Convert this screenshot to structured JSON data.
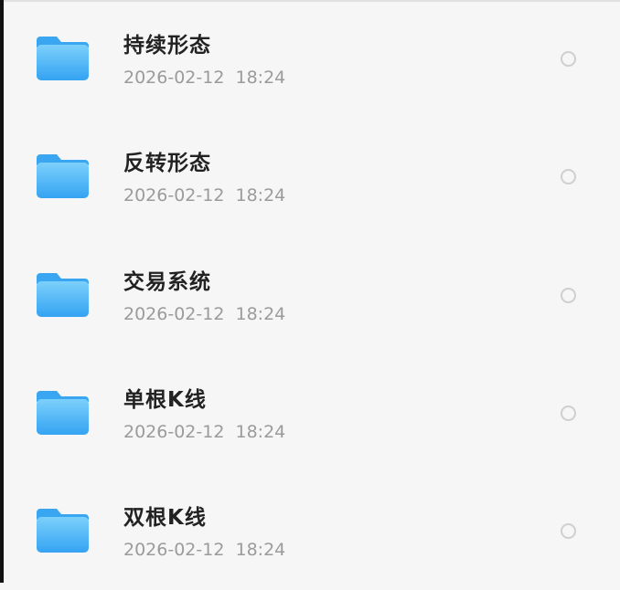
{
  "files": {
    "items": [
      {
        "name": "持续形态",
        "date": "2026-02-12  18:24",
        "icon": "folder-icon",
        "selected": false
      },
      {
        "name": "反转形态",
        "date": "2026-02-12  18:24",
        "icon": "folder-icon",
        "selected": false
      },
      {
        "name": "交易系统",
        "date": "2026-02-12  18:24",
        "icon": "folder-icon",
        "selected": false
      },
      {
        "name": "单根K线",
        "date": "2026-02-12  18:24",
        "icon": "folder-icon",
        "selected": false
      },
      {
        "name": "双根K线",
        "date": "2026-02-12  18:24",
        "icon": "folder-icon",
        "selected": false
      }
    ]
  },
  "colors": {
    "folder_light": "#6ec7f8",
    "folder_dark": "#2f9ff0",
    "background": "#f6f6f6"
  }
}
